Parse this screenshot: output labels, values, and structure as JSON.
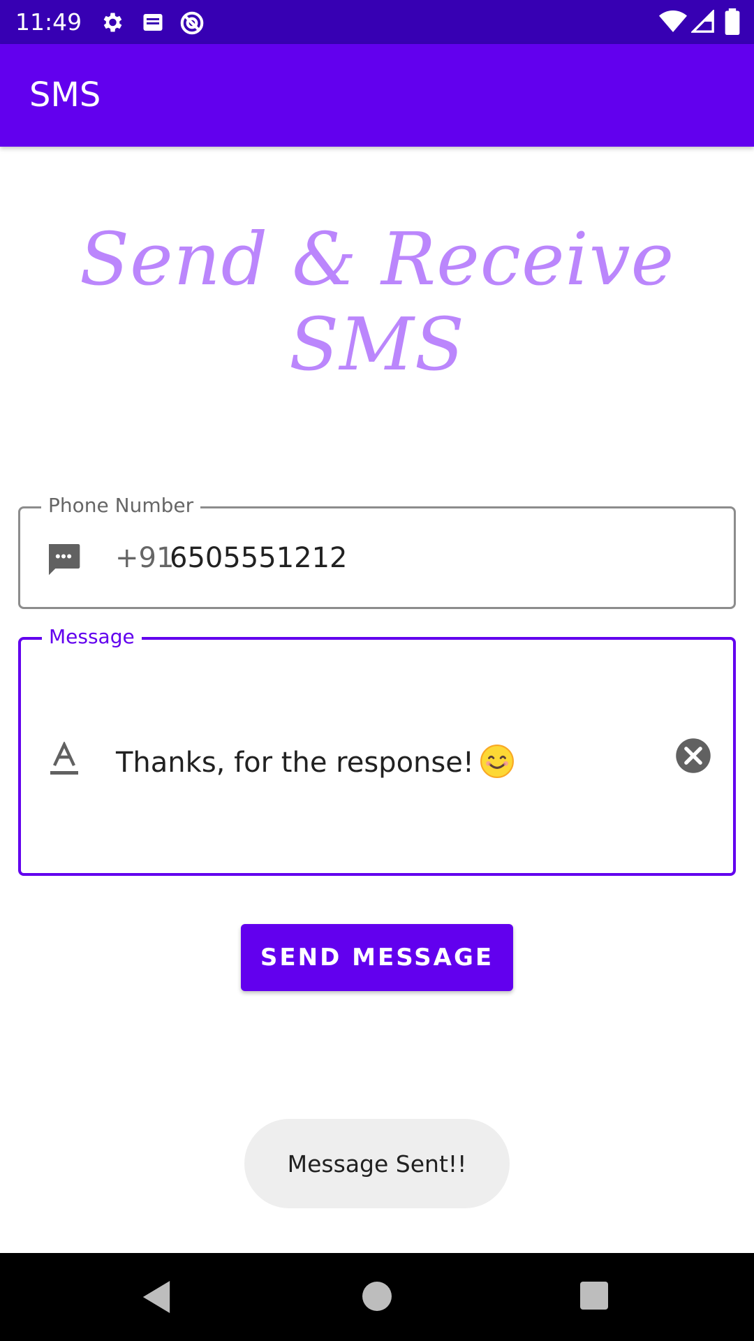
{
  "status_bar": {
    "time": "11:49",
    "icons": [
      "settings-icon",
      "notification-icon",
      "sync-disabled-icon",
      "wifi-icon",
      "cell-signal-icon",
      "battery-icon"
    ]
  },
  "app_bar": {
    "title": "SMS"
  },
  "headline": "Send & Receive SMS",
  "phone_field": {
    "label": "Phone Number",
    "prefix": "+91",
    "value": "6505551212",
    "icon": "message-dots-icon"
  },
  "message_field": {
    "label": "Message",
    "value": "Thanks, for the response!",
    "icon": "text-format-icon",
    "emoji": "smiling-face-emoji"
  },
  "send_button": {
    "label": "SEND MESSAGE"
  },
  "toast": {
    "text": "Message Sent!!"
  },
  "colors": {
    "status_bar": "#3700b3",
    "primary": "#6200ee",
    "headline": "#bb86fc",
    "toast_bg": "#eeeeee"
  }
}
